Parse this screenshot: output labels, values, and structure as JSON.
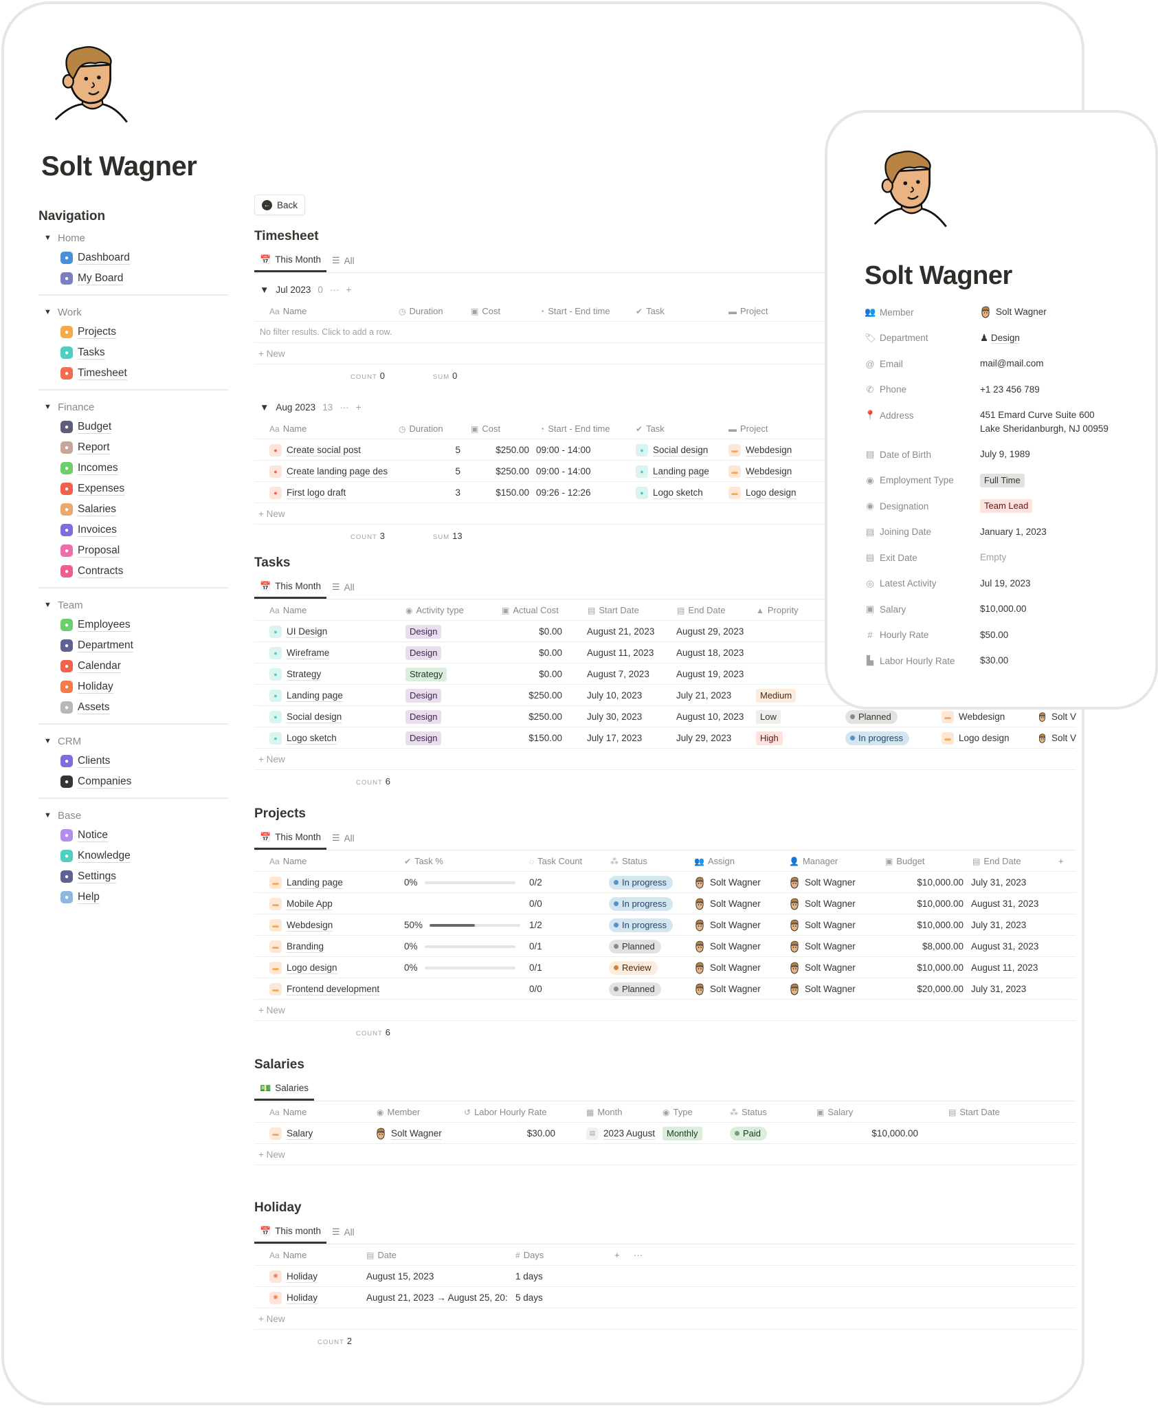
{
  "page": {
    "title": "Solt Wagner",
    "avatar_icon": "person-cartoon-avatar"
  },
  "sidebar": {
    "title": "Navigation",
    "groups": [
      {
        "label": "Home",
        "items": [
          {
            "label": "Dashboard",
            "icon": "dashboard-icon",
            "color": "#4a90d9"
          },
          {
            "label": "My Board",
            "icon": "board-icon",
            "color": "#7a7fbf"
          }
        ]
      },
      {
        "label": "Work",
        "items": [
          {
            "label": "Projects",
            "icon": "folder-icon",
            "color": "#f5a94a"
          },
          {
            "label": "Tasks",
            "icon": "check-icon",
            "color": "#4fcfc0"
          },
          {
            "label": "Timesheet",
            "icon": "clock-icon",
            "color": "#f26d50"
          }
        ]
      },
      {
        "label": "Finance",
        "items": [
          {
            "label": "Budget",
            "icon": "budget-icon",
            "color": "#5c5e7a"
          },
          {
            "label": "Report",
            "icon": "report-icon",
            "color": "#c6a79a"
          },
          {
            "label": "Incomes",
            "icon": "income-icon",
            "color": "#6ccf6c"
          },
          {
            "label": "Expenses",
            "icon": "expense-icon",
            "color": "#f2624a"
          },
          {
            "label": "Salaries",
            "icon": "salary-icon",
            "color": "#e9a96e"
          },
          {
            "label": "Invoices",
            "icon": "invoice-icon",
            "color": "#7d6ee0"
          },
          {
            "label": "Proposal",
            "icon": "proposal-icon",
            "color": "#ee6fa8"
          },
          {
            "label": "Contracts",
            "icon": "contract-icon",
            "color": "#ec5f8f"
          }
        ]
      },
      {
        "label": "Team",
        "items": [
          {
            "label": "Employees",
            "icon": "employees-icon",
            "color": "#6ccf6c"
          },
          {
            "label": "Department",
            "icon": "department-icon",
            "color": "#5c6390"
          },
          {
            "label": "Calendar",
            "icon": "calendar-icon",
            "color": "#f2624a"
          },
          {
            "label": "Holiday",
            "icon": "sun-icon",
            "color": "#f57a4a"
          },
          {
            "label": "Assets",
            "icon": "monitor-icon",
            "color": "#b8b8b6"
          }
        ]
      },
      {
        "label": "CRM",
        "items": [
          {
            "label": "Clients",
            "icon": "clients-icon",
            "color": "#7d6ee0"
          },
          {
            "label": "Companies",
            "icon": "building-icon",
            "color": "#37352f"
          }
        ]
      },
      {
        "label": "Base",
        "items": [
          {
            "label": "Notice",
            "icon": "chat-icon",
            "color": "#b48cea"
          },
          {
            "label": "Knowledge",
            "icon": "book-icon",
            "color": "#4fcfc0"
          },
          {
            "label": "Settings",
            "icon": "gear-icon",
            "color": "#5c6390"
          },
          {
            "label": "Help",
            "icon": "help-icon",
            "color": "#8fb8e0"
          }
        ]
      }
    ]
  },
  "main": {
    "back_label": "Back",
    "timesheet": {
      "title": "Timesheet",
      "tabs": [
        "This Month",
        "All"
      ],
      "columns": [
        "Name",
        "Duration",
        "Cost",
        "Start - End time",
        "Task",
        "Project"
      ],
      "groups": [
        {
          "label": "Jul 2023",
          "count": "0",
          "empty_text": "No filter results. Click to add a row.",
          "rows": [],
          "calc_count": "0",
          "calc_sum": "0"
        },
        {
          "label": "Aug 2023",
          "count": "13",
          "empty_text": "",
          "rows": [
            {
              "name": "Create social post",
              "duration": "5",
              "cost": "$250.00",
              "time": "09:00 - 14:00",
              "task": "Social design",
              "project": "Webdesign"
            },
            {
              "name": "Create landing page des",
              "duration": "5",
              "cost": "$250.00",
              "time": "09:00 - 14:00",
              "task": "Landing page",
              "project": "Webdesign"
            },
            {
              "name": "First logo draft",
              "duration": "3",
              "cost": "$150.00",
              "time": "09:26 - 12:26",
              "task": "Logo sketch",
              "project": "Logo design"
            }
          ],
          "calc_count": "3",
          "calc_sum": "13"
        }
      ],
      "new_label": "New",
      "count_label": "COUNT",
      "sum_label": "SUM"
    },
    "tasks": {
      "title": "Tasks",
      "tabs": [
        "This Month",
        "All"
      ],
      "columns": [
        "Name",
        "Activity type",
        "Actual Cost",
        "Start Date",
        "End Date",
        "Proprity"
      ],
      "rows": [
        {
          "name": "UI Design",
          "activity": "Design",
          "cost": "$0.00",
          "start": "August 21, 2023",
          "end": "August 29, 2023",
          "priority": "",
          "status": "",
          "project": "",
          "assignee": ""
        },
        {
          "name": "Wireframe",
          "activity": "Design",
          "cost": "$0.00",
          "start": "August 11, 2023",
          "end": "August 18, 2023",
          "priority": "",
          "status": "",
          "project": "",
          "assignee": ""
        },
        {
          "name": "Strategy",
          "activity": "Strategy",
          "cost": "$0.00",
          "start": "August 7, 2023",
          "end": "August 19, 2023",
          "priority": "",
          "status": "",
          "project": "",
          "assignee": ""
        },
        {
          "name": "Landing page",
          "activity": "Design",
          "cost": "$250.00",
          "start": "July 10, 2023",
          "end": "July 21, 2023",
          "priority": "Medium",
          "status": "",
          "project": "",
          "assignee": ""
        },
        {
          "name": "Social design",
          "activity": "Design",
          "cost": "$250.00",
          "start": "July 30, 2023",
          "end": "August 10, 2023",
          "priority": "Low",
          "status": "Planned",
          "project": "Webdesign",
          "assignee": "Solt V"
        },
        {
          "name": "Logo sketch",
          "activity": "Design",
          "cost": "$150.00",
          "start": "July 17, 2023",
          "end": "July 29, 2023",
          "priority": "High",
          "status": "In progress",
          "project": "Logo design",
          "assignee": "Solt V"
        }
      ],
      "new_label": "New",
      "count_label": "COUNT",
      "count": "6"
    },
    "projects": {
      "title": "Projects",
      "tabs": [
        "This Month",
        "All"
      ],
      "columns": [
        "Name",
        "Task %",
        "Task Count",
        "Status",
        "Assign",
        "Manager",
        "Budget",
        "End Date"
      ],
      "rows": [
        {
          "name": "Landing page",
          "pct_label": "0%",
          "pct": 0,
          "count": "0/2",
          "status": "In progress",
          "assign": "Solt Wagner",
          "manager": "Solt Wagner",
          "budget": "$10,000.00",
          "end": "July 31, 2023"
        },
        {
          "name": "Mobile App",
          "pct_label": "",
          "pct": null,
          "count": "0/0",
          "status": "In progress",
          "assign": "Solt Wagner",
          "manager": "Solt Wagner",
          "budget": "$10,000.00",
          "end": "August 31, 2023"
        },
        {
          "name": "Webdesign",
          "pct_label": "50%",
          "pct": 50,
          "count": "1/2",
          "status": "In progress",
          "assign": "Solt Wagner",
          "manager": "Solt Wagner",
          "budget": "$10,000.00",
          "end": "July 31, 2023"
        },
        {
          "name": "Branding",
          "pct_label": "0%",
          "pct": 0,
          "count": "0/1",
          "status": "Planned",
          "assign": "Solt Wagner",
          "manager": "Solt Wagner",
          "budget": "$8,000.00",
          "end": "August 31, 2023"
        },
        {
          "name": "Logo design",
          "pct_label": "0%",
          "pct": 0,
          "count": "0/1",
          "status": "Review",
          "assign": "Solt Wagner",
          "manager": "Solt Wagner",
          "budget": "$10,000.00",
          "end": "August 11, 2023"
        },
        {
          "name": "Frontend development",
          "pct_label": "",
          "pct": null,
          "count": "0/0",
          "status": "Planned",
          "assign": "Solt Wagner",
          "manager": "Solt Wagner",
          "budget": "$20,000.00",
          "end": "July 31, 2023"
        }
      ],
      "new_label": "New",
      "count_label": "COUNT",
      "count": "6"
    },
    "salaries": {
      "title": "Salaries",
      "tabs": [
        "Salaries"
      ],
      "columns": [
        "Name",
        "Member",
        "Labor Hourly Rate",
        "Month",
        "Type",
        "Status",
        "Salary",
        "Start Date"
      ],
      "rows": [
        {
          "name": "Salary",
          "member": "Solt Wagner",
          "rate": "$30.00",
          "month": "2023 August",
          "type": "Monthly",
          "status": "Paid",
          "salary": "$10,000.00",
          "start": ""
        }
      ],
      "new_label": "New"
    },
    "holiday": {
      "title": "Holiday",
      "tabs": [
        "This month",
        "All"
      ],
      "columns": [
        "Name",
        "Date",
        "Days"
      ],
      "rows": [
        {
          "name": "Holiday",
          "date": "August 15, 2023",
          "days": "1 days"
        },
        {
          "name": "Holiday",
          "date": "August 21, 2023 → August 25, 20:",
          "days": "5 days"
        }
      ],
      "new_label": "New",
      "count_label": "COUNT",
      "count": "2"
    }
  },
  "status_colors": {
    "In progress": {
      "bg": "#d3e5ef",
      "dot": "#5a8fcf",
      "fg": "#28456c"
    },
    "Planned": {
      "bg": "#e3e2e0",
      "dot": "#8a8985",
      "fg": "#37352f"
    },
    "Review": {
      "bg": "#fbecdd",
      "dot": "#d9822b",
      "fg": "#49290e"
    },
    "Paid": {
      "bg": "#dbeddb",
      "dot": "#7a9e7a",
      "fg": "#1c3829"
    }
  },
  "tag_colors": {
    "Design": {
      "bg": "#e8deee",
      "fg": "#412454"
    },
    "Strategy": {
      "bg": "#dbeddb",
      "fg": "#1c3829"
    },
    "Medium": {
      "bg": "#fbecdd",
      "fg": "#49290e"
    },
    "Low": {
      "bg": "#eeeeec",
      "fg": "#37352f"
    },
    "High": {
      "bg": "#ffe2dd",
      "fg": "#5d1715"
    },
    "Monthly": {
      "bg": "#dbeddb",
      "fg": "#1c3829"
    },
    "Full Time": {
      "bg": "#e3e2e0",
      "fg": "#37352f"
    },
    "Team Lead": {
      "bg": "#ffe2dd",
      "fg": "#5d1715"
    }
  },
  "profile_card": {
    "title": "Solt Wagner",
    "properties": [
      {
        "key": "Member",
        "icon": "people-icon",
        "value": "Solt Wagner",
        "kind": "person"
      },
      {
        "key": "Department",
        "icon": "tag-icon",
        "value": "Design",
        "kind": "relation"
      },
      {
        "key": "Email",
        "icon": "at-icon",
        "value": "mail@mail.com",
        "kind": "text"
      },
      {
        "key": "Phone",
        "icon": "phone-icon",
        "value": "+1 23 456 789",
        "kind": "text"
      },
      {
        "key": "Address",
        "icon": "pin-icon",
        "value": "451 Emard Curve Suite 600\nLake Sheridanburgh, NJ 00959",
        "kind": "text"
      },
      {
        "key": "Date of Birth",
        "icon": "calendar-icon",
        "value": "July 9, 1989",
        "kind": "text"
      },
      {
        "key": "Employment Type",
        "icon": "select-icon",
        "value": "Full Time",
        "kind": "tag"
      },
      {
        "key": "Designation",
        "icon": "user-circle-icon",
        "value": "Team Lead",
        "kind": "tag"
      },
      {
        "key": "Joining Date",
        "icon": "calendar-icon",
        "value": "January 1, 2023",
        "kind": "text"
      },
      {
        "key": "Exit Date",
        "icon": "calendar-icon",
        "value": "Empty",
        "kind": "empty"
      },
      {
        "key": "Latest Activity",
        "icon": "target-icon",
        "value": "Jul 19, 2023",
        "kind": "text"
      },
      {
        "key": "Salary",
        "icon": "money-icon",
        "value": "$10,000.00",
        "kind": "text"
      },
      {
        "key": "Hourly Rate",
        "icon": "hash-icon",
        "value": "$50.00",
        "kind": "text"
      },
      {
        "key": "Labor Hourly Rate",
        "icon": "chart-icon",
        "value": "$30.00",
        "kind": "text"
      }
    ]
  }
}
